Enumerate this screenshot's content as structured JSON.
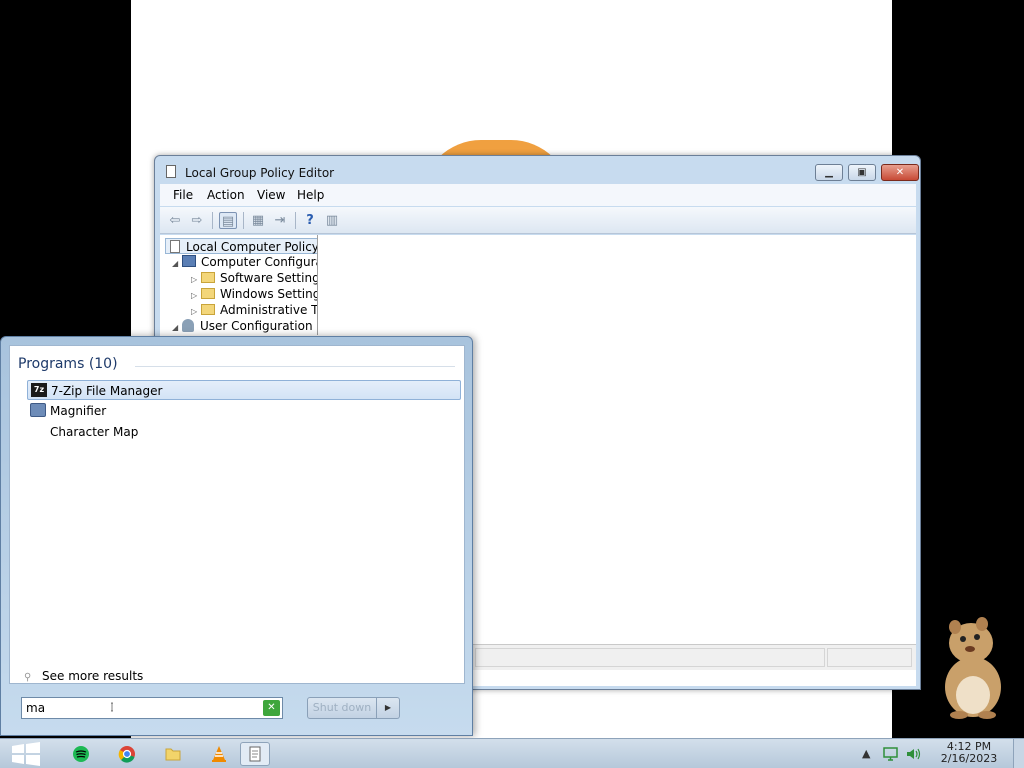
{
  "gpedit": {
    "title": "Local Group Policy Editor",
    "menu": [
      "File",
      "Action",
      "View",
      "Help"
    ],
    "tree": {
      "root": "Local Computer Policy",
      "computer_config": "Computer Configura",
      "software_settings": "Software Setting",
      "windows_settings": "Windows Setting",
      "admin_templates": "Administrative Te",
      "user_config": "User Configuration"
    }
  },
  "start_menu": {
    "programs_header": "Programs (10)",
    "results": [
      {
        "label": "7-Zip File Manager",
        "icon": "7zip-icon",
        "selected": true
      },
      {
        "label": "Magnifier",
        "icon": "magnifier-icon",
        "selected": false
      },
      {
        "label": "Character Map",
        "icon": "character-map-icon",
        "selected": false
      }
    ],
    "see_more": "See more results",
    "search_value": "ma",
    "shutdown_label": "Shut down"
  },
  "taskbar": {
    "time": "4:12 PM",
    "date": "2/16/2023"
  },
  "colors": {
    "accent": "#c7dbef",
    "selection": "#d3e3f6",
    "close_button": "#c74a36",
    "search_clear": "#3ea63c"
  }
}
